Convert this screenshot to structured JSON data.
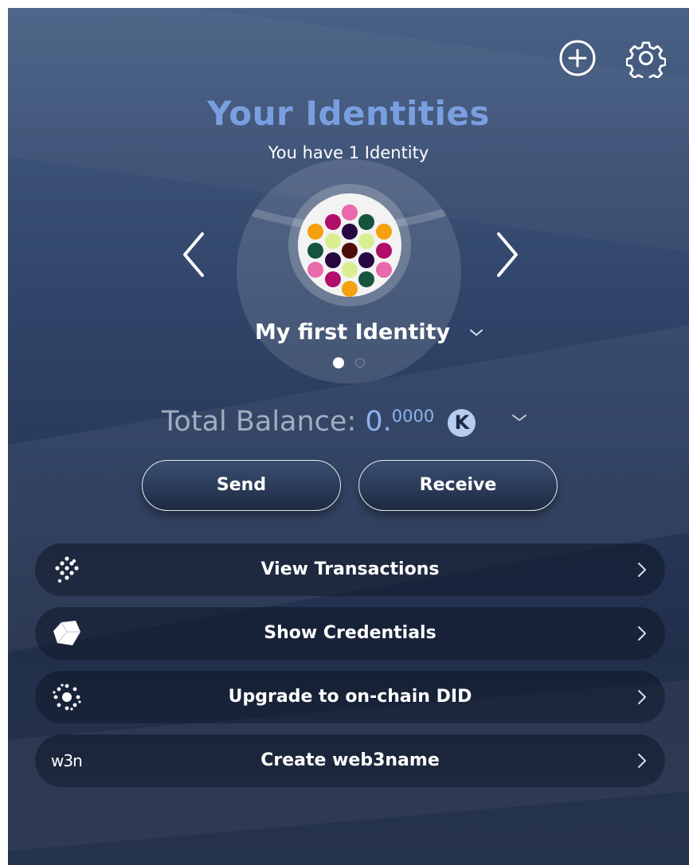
{
  "header": {
    "title": "Your Identities",
    "subtitle": "You have 1 Identity",
    "add_icon": "plus-circle-icon",
    "settings_icon": "gear-icon"
  },
  "identity": {
    "name": "My first Identity",
    "avatar_colors": [
      "#e96aaa",
      "#b10d6a",
      "#16543e",
      "#f5a00f",
      "#d9ee91",
      "#260941",
      "#4e0d0a"
    ],
    "page_count": 2,
    "active_page": 1
  },
  "balance": {
    "label": "Total Balance:",
    "amount_integer": "0.",
    "amount_decimals": "0000",
    "currency_icon": "K"
  },
  "actions": {
    "send_label": "Send",
    "receive_label": "Receive"
  },
  "menu": [
    {
      "label": "View Transactions",
      "icon": "transactions-icon"
    },
    {
      "label": "Show Credentials",
      "icon": "cube-icon"
    },
    {
      "label": "Upgrade to on-chain DID",
      "icon": "did-burst-icon"
    },
    {
      "label": "Create web3name",
      "icon": "web3name-icon",
      "icon_text": "w3n"
    }
  ],
  "colors": {
    "title": "#7a9fe0",
    "balance_amount": "#8eb3ea",
    "background_top": "#4a6186",
    "background_bottom": "#222f4b"
  }
}
